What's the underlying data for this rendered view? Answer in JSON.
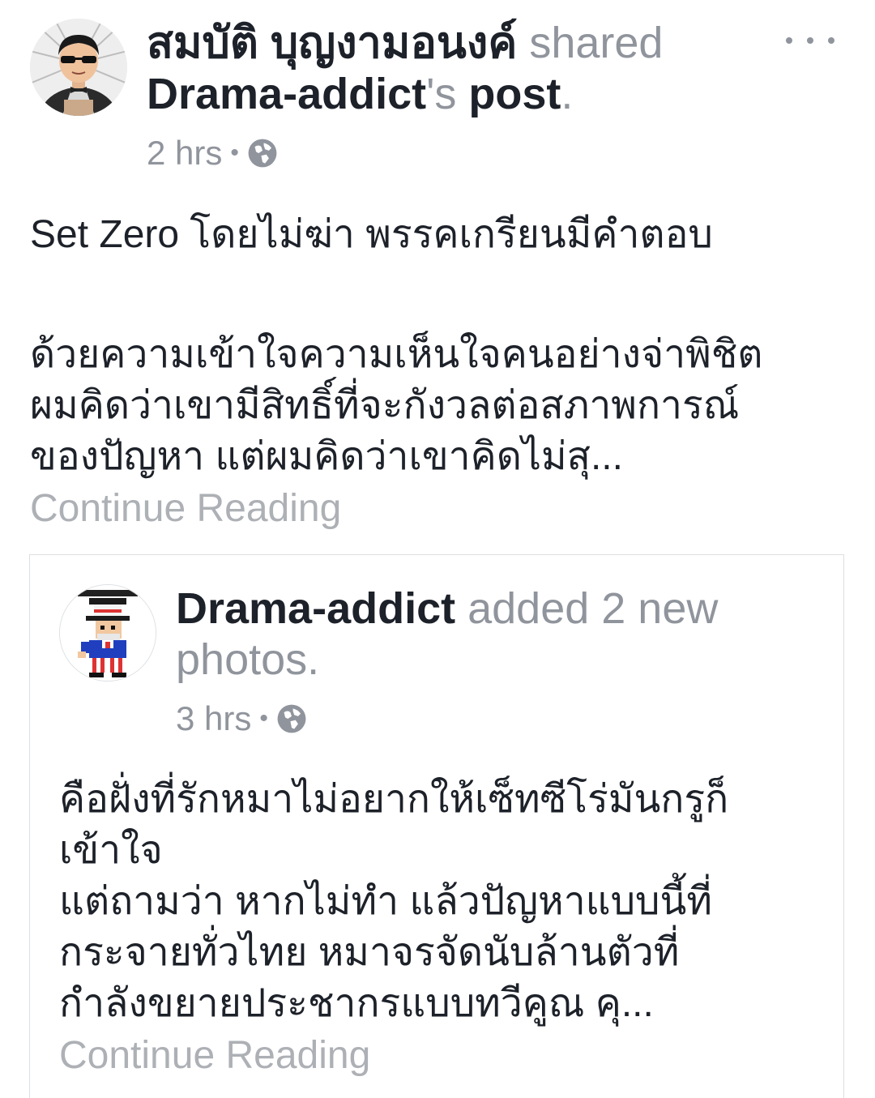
{
  "post": {
    "author": "สมบัติ บุญงามอนงค์",
    "shared_word": " shared",
    "source_name": "Drama-addict",
    "possessive": "'s ",
    "post_word": "post",
    "period": ".",
    "time": "2 hrs",
    "separator": "•",
    "body_line1": "Set Zero โดยไม่ฆ่า พรรคเกรียนมีคำตอบ",
    "body_line2": "ด้วยความเข้าใจความเห็นใจคนอย่างจ่าพิชิต",
    "body_line3": "ผมคิดว่าเขามีสิทธิ์ที่จะกังวลต่อสภาพการณ์",
    "body_line4": "ของปัญหา แต่ผมคิดว่าเขาคิดไม่สุ...",
    "continue_label": "Continue Reading"
  },
  "shared": {
    "author": "Drama-addict",
    "action": " added 2 new photos.",
    "time": "3 hrs",
    "separator": "•",
    "body_line1": "คือฝั่งที่รักหมาไม่อยากให้เซ็ทซีโร่มันกรูก็",
    "body_line2": "เข้าใจ",
    "body_line3": "แต่ถามว่า หากไม่ทำ แล้วปัญหาแบบนี้ที่",
    "body_line4": "กระจายทั่วไทย หมาจรจัดนับล้านตัวที่",
    "body_line5": "กำลังขยายประชากรแบบทวีคูณ คุ...",
    "continue_label": "Continue Reading"
  },
  "icons": {
    "more": "more-options-icon",
    "privacy": "globe-icon"
  },
  "colors": {
    "text": "#1d2129",
    "secondary": "#90949c",
    "link_faded": "#adb0b5",
    "border": "#dddfe2"
  }
}
